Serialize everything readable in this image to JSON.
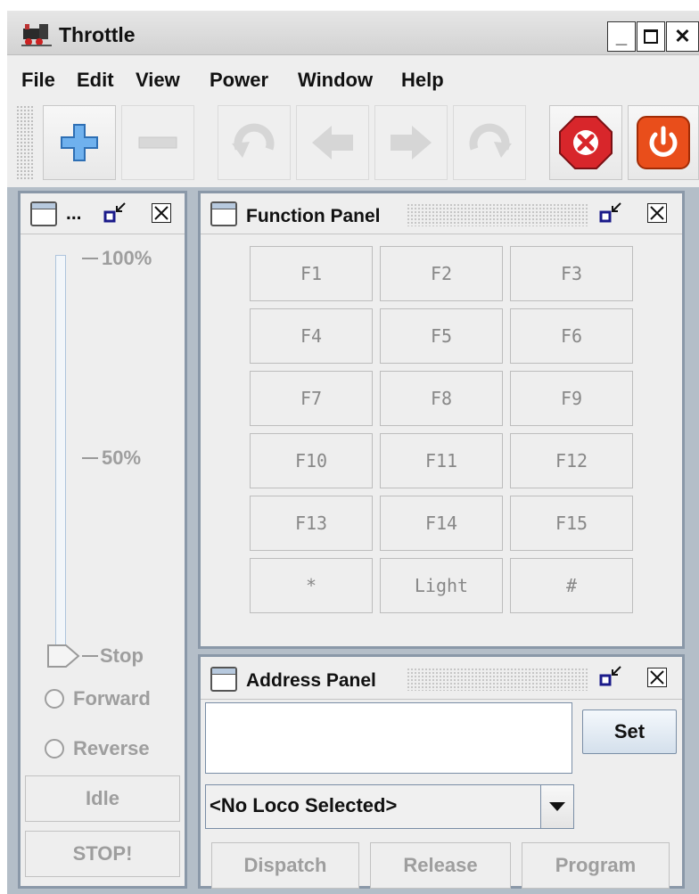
{
  "window": {
    "title": "Throttle"
  },
  "menu": [
    "File",
    "Edit",
    "View",
    "Power",
    "Window",
    "Help"
  ],
  "toolbar": {
    "buttons": [
      {
        "icon": "add-icon",
        "enabled": true
      },
      {
        "icon": "remove-icon",
        "enabled": false
      },
      {
        "icon": "undo-icon",
        "enabled": false
      },
      {
        "icon": "back-arrow-icon",
        "enabled": false
      },
      {
        "icon": "forward-arrow-icon",
        "enabled": false
      },
      {
        "icon": "redo-icon",
        "enabled": false
      },
      {
        "icon": "stop-all-icon",
        "enabled": true
      },
      {
        "icon": "power-icon",
        "enabled": true
      }
    ],
    "colors": {
      "stop": "#d8262b",
      "power": "#e94e1b",
      "add": "#5aa0e6"
    }
  },
  "control_panel": {
    "title": "...",
    "speed_labels": {
      "max": "100%",
      "mid": "50%",
      "min": "Stop"
    },
    "speed_value": 0,
    "forward_label": "Forward",
    "reverse_label": "Reverse",
    "idle_label": "Idle",
    "stop_label": "STOP!"
  },
  "function_panel": {
    "title": "Function Panel",
    "buttons": [
      "F1",
      "F2",
      "F3",
      "F4",
      "F5",
      "F6",
      "F7",
      "F8",
      "F9",
      "F10",
      "F11",
      "F12",
      "F13",
      "F14",
      "F15",
      "*",
      "Light",
      "#"
    ]
  },
  "address_panel": {
    "title": "Address Panel",
    "address_value": "",
    "set_label": "Set",
    "roster_selected": "<No Loco Selected>",
    "dispatch_label": "Dispatch",
    "release_label": "Release",
    "program_label": "Program"
  }
}
